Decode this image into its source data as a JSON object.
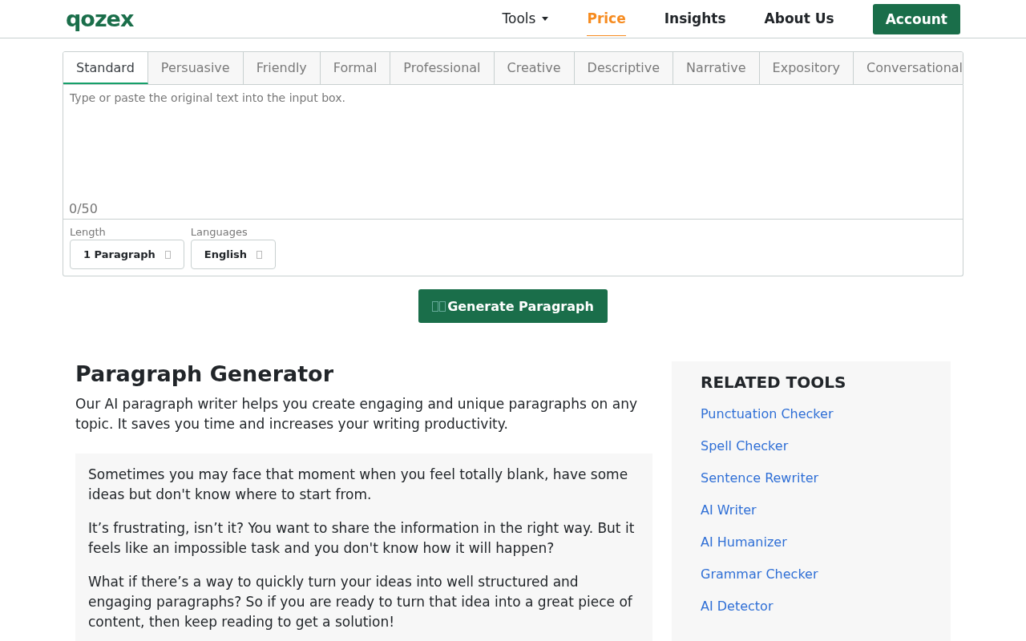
{
  "header": {
    "logo": "qozex",
    "nav": [
      {
        "label": "Tools",
        "kind": "dropdown",
        "selected": false
      },
      {
        "label": "Price",
        "kind": "link",
        "selected": true
      },
      {
        "label": "Insights",
        "kind": "link",
        "selected": false
      },
      {
        "label": "About Us",
        "kind": "link",
        "selected": false
      },
      {
        "label": "Account",
        "kind": "button",
        "selected": false
      }
    ]
  },
  "tabs": [
    {
      "label": "Standard",
      "selected": true
    },
    {
      "label": "Persuasive",
      "selected": false
    },
    {
      "label": "Friendly",
      "selected": false
    },
    {
      "label": "Formal",
      "selected": false
    },
    {
      "label": "Professional",
      "selected": false
    },
    {
      "label": "Creative",
      "selected": false
    },
    {
      "label": "Descriptive",
      "selected": false
    },
    {
      "label": "Narrative",
      "selected": false
    },
    {
      "label": "Expository",
      "selected": false
    },
    {
      "label": "Conversational",
      "selected": false
    }
  ],
  "input": {
    "placeholder": "Type or paste the original text into the input box.",
    "counter": "0/50"
  },
  "options": [
    {
      "label": "Length",
      "value": "1 Paragraph"
    },
    {
      "label": "Languages",
      "value": "English"
    }
  ],
  "generate_button": "Generate Paragraph",
  "article": {
    "title": "Paragraph Generator",
    "intro": "Our AI paragraph writer helps you create engaging and unique paragraphs on any topic. It saves you time and increases your writing productivity.",
    "callout": [
      "Sometimes you may face that moment when you feel totally blank, have some ideas but don't know where to start from.",
      "It’s frustrating, isn’t it? You want to share the information in the right way. But it feels like an impossible task and you don't know how it will happen?",
      "What if there’s a way to quickly turn your ideas into well structured and engaging paragraphs? So if you are ready to turn that idea into a great piece of content, then keep reading to get a solution!"
    ]
  },
  "related_tools": {
    "title": "RELATED TOOLS",
    "items": [
      "Punctuation Checker",
      "Spell Checker",
      "Sentence Rewriter",
      "AI Writer",
      "AI Humanizer",
      "Grammar Checker",
      "AI Detector"
    ]
  }
}
